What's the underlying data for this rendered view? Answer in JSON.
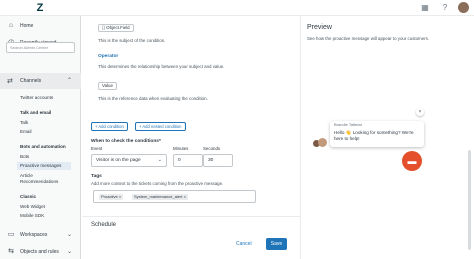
{
  "sidebar": {
    "home": "Home",
    "recently_viewed": "Recently viewed",
    "search_placeholder": "Search Admin Center",
    "channels": "Channels",
    "twitter_accounts": "Twitter accounts",
    "talk_email_head": "Talk and email",
    "talk": "Talk",
    "email": "Email",
    "bots_head": "Bots and automation",
    "bots": "Bots",
    "proactive": "Proactive messages",
    "article_recs": "Article Recommendations",
    "classic_head": "Classic",
    "web_widget": "Web Widget",
    "mobile_sdk": "Mobile SDK",
    "workspaces": "Workspaces",
    "objects_rules": "Objects and rules"
  },
  "main": {
    "object_field": "Object.Field",
    "subject_help": "This is the subject of the condition.",
    "operator_label": "Operator",
    "operator_help": "This determines the relationship between your subject and value.",
    "value_pill": "Value",
    "value_help": "This is the reference data when evaluating the condition.",
    "add_condition": "Add condition",
    "add_nested": "Add nested condition",
    "when_label": "When to check the conditions*",
    "event_label": "Event",
    "minutes_label": "Minutes",
    "seconds_label": "Seconds",
    "event_value": "Visitor is on the page",
    "minutes_value": "0",
    "seconds_value": "30",
    "tags_label": "Tags",
    "tags_help": "Add more context to the tickets coming from the proactive message.",
    "tags": [
      "Proactive",
      "System_maintenance_alert"
    ],
    "schedule_label": "Schedule",
    "cancel": "Cancel",
    "save": "Save"
  },
  "preview": {
    "title": "Preview",
    "description": "See how the proactive message will appear to your customers.",
    "agent_name": "Brandie Taltmat",
    "message": "Hello 👋 Looking for something? We're here to help!",
    "close": "×"
  },
  "colors": {
    "accent": "#1f73b7",
    "launcher": "#e3502b"
  }
}
